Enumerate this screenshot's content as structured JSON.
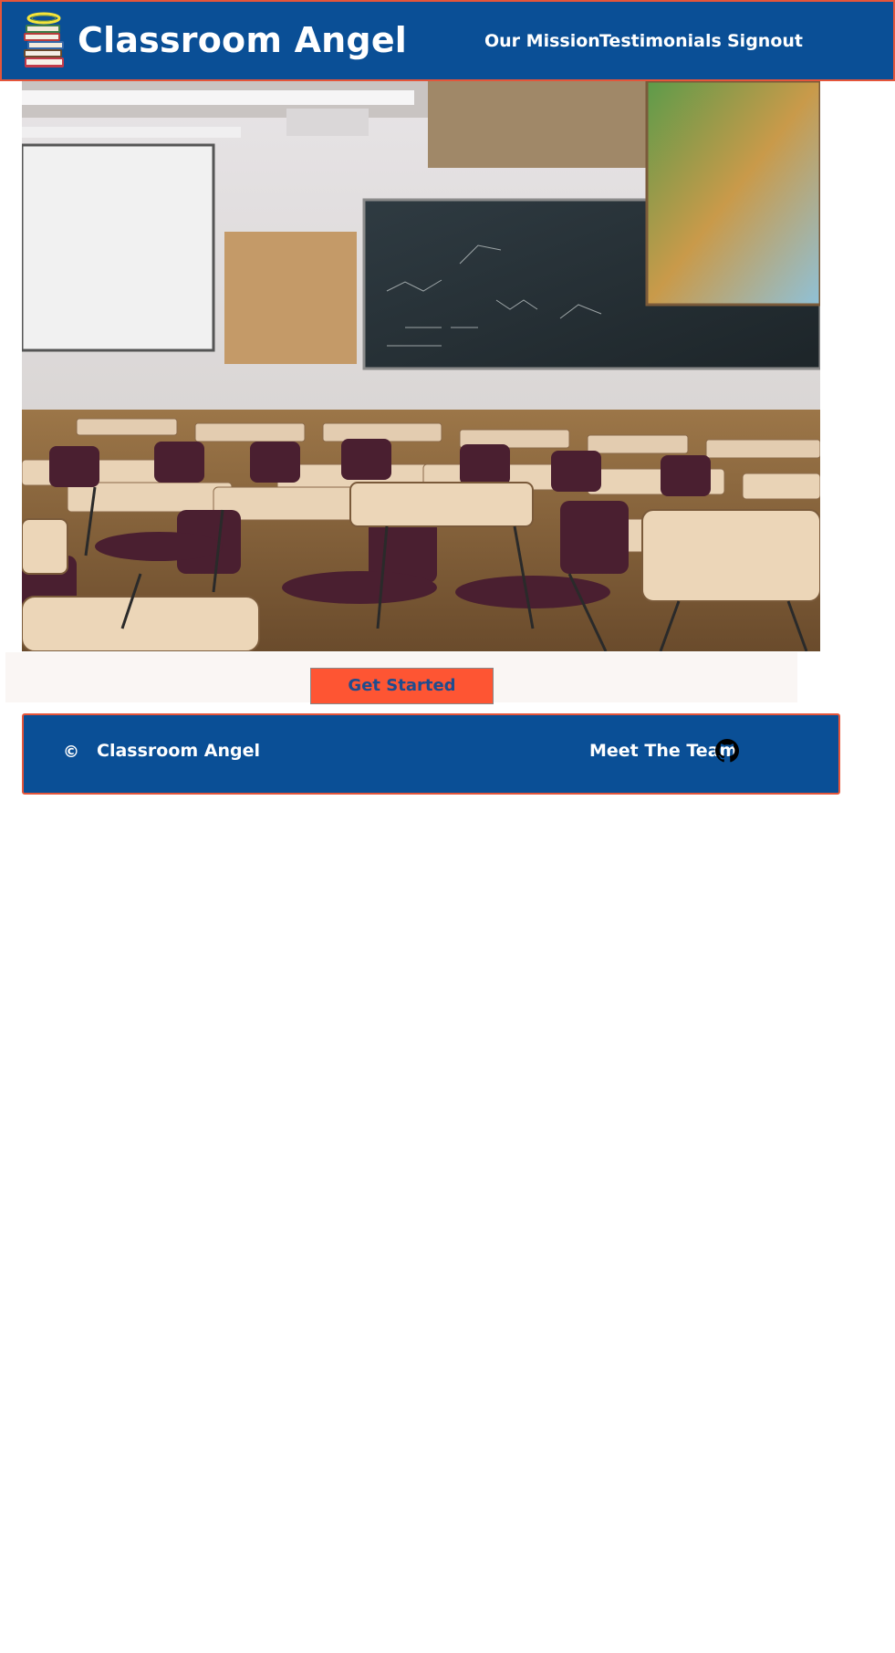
{
  "header": {
    "brand": "Classroom Angel",
    "logo_icon": "books-with-halo-icon",
    "nav": {
      "our_mission": "Our Mission",
      "testimonials": "Testimonials",
      "signout": "Signout"
    }
  },
  "hero": {
    "image_icon": "classroom-photo"
  },
  "cta": {
    "label": "Get Started"
  },
  "footer": {
    "copyright_symbol": "©",
    "brand": "Classroom Angel",
    "team_link": "Meet The Team",
    "team_icon": "github-icon"
  },
  "colors": {
    "brand_blue": "#0a4f96",
    "accent_orange": "#fe5533",
    "border_red": "#e5553a",
    "cta_text": "#1e4c8e"
  }
}
